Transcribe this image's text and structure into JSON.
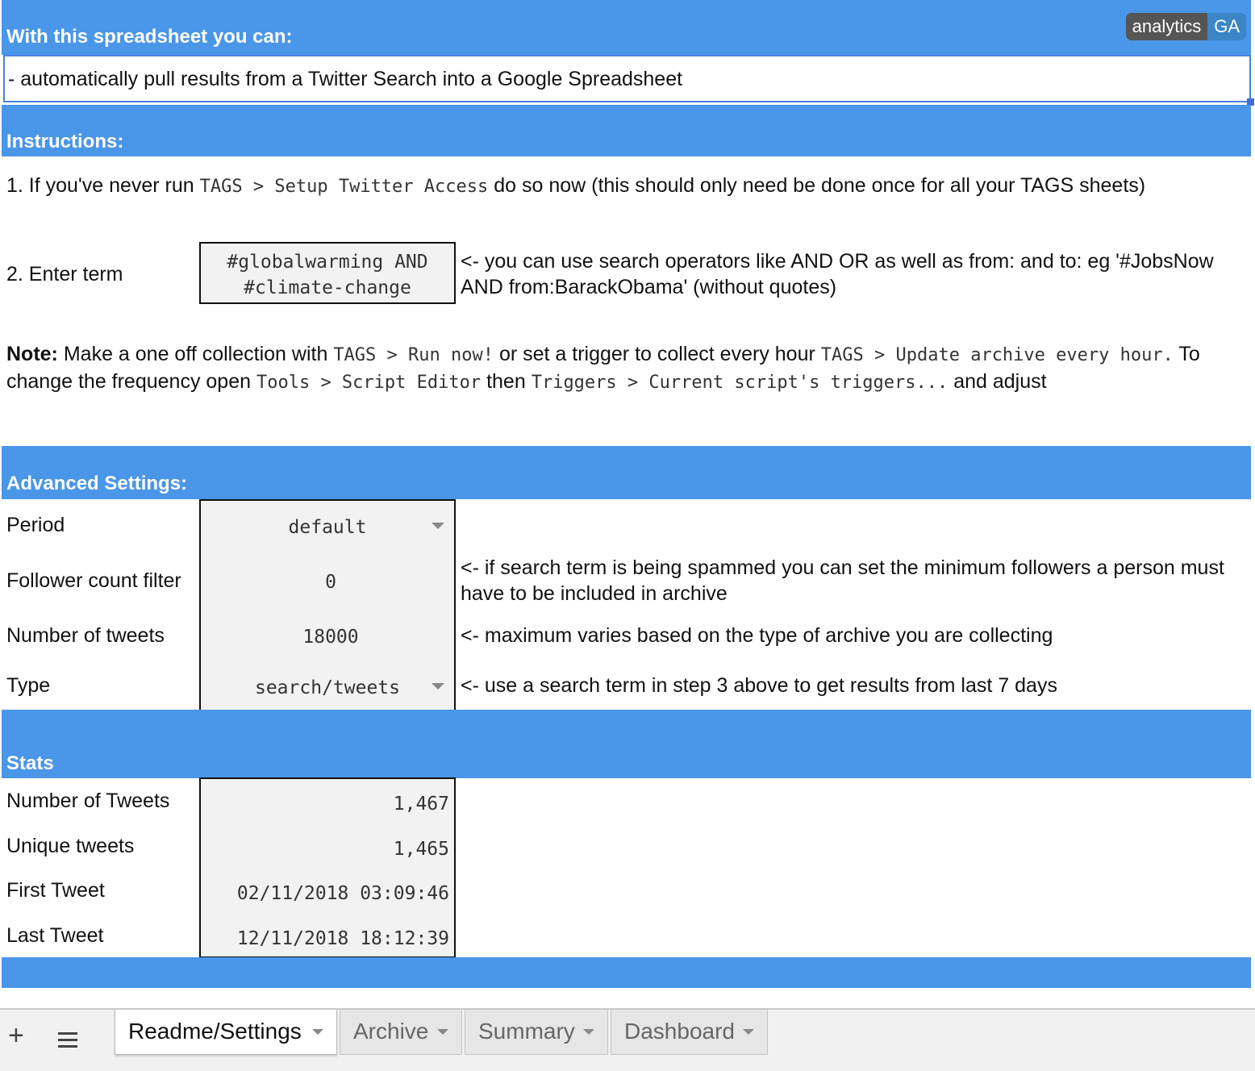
{
  "badge": {
    "left": "analytics",
    "right": "GA"
  },
  "intro": {
    "header": "With this spreadsheet you can:",
    "line": "- automatically pull results from a Twitter Search into a Google Spreadsheet"
  },
  "instructions": {
    "header": "Instructions:",
    "step1": {
      "pre": "1. If you've never run",
      "code": "TAGS > Setup Twitter Access",
      "post": "do so now (this should only need be done once for all your TAGS sheets)"
    },
    "step2": {
      "label": "2. Enter term",
      "term_line1": "#globalwarming AND",
      "term_line2": "#climate-change",
      "hint": "<- you can use search operators like AND OR as well as from: and to: eg '#JobsNow AND from:BarackObama' (without quotes)"
    },
    "note": {
      "label": "Note:",
      "t1": "Make a one off collection with",
      "c1": "TAGS > Run now!",
      "t2": "or set a trigger to collect every hour",
      "c2": "TAGS > Update archive every hour.",
      "t3": "To change the frequency open",
      "c3": "Tools > Script Editor",
      "t4": "then",
      "c4": "Triggers > Current script's triggers...",
      "t5": "and adjust"
    }
  },
  "advanced": {
    "header": "Advanced Settings:",
    "period": {
      "label": "Period",
      "value": "default"
    },
    "follower": {
      "label": "Follower count filter",
      "value": "0",
      "hint": "<- if search term is being spammed you can set the minimum followers a person must have to be included in archive"
    },
    "tweets": {
      "label": "Number of tweets",
      "value": "18000",
      "hint": "<- maximum varies based on the type of archive you are collecting"
    },
    "type": {
      "label": "Type",
      "value": "search/tweets",
      "hint": "<- use a search term in step 3 above to get results from last 7 days"
    }
  },
  "stats": {
    "header": "Stats",
    "rows": [
      {
        "label": "Number of Tweets",
        "value": "1,467"
      },
      {
        "label": "Unique tweets",
        "value": "1,465"
      },
      {
        "label": "First Tweet",
        "value": "02/11/2018 03:09:46"
      },
      {
        "label": "Last Tweet",
        "value": "12/11/2018 18:12:39"
      }
    ]
  },
  "tabs": [
    {
      "label": "Readme/Settings",
      "active": true
    },
    {
      "label": "Archive",
      "active": false
    },
    {
      "label": "Summary",
      "active": false
    },
    {
      "label": "Dashboard",
      "active": false
    }
  ],
  "icons": {
    "add": "plus-icon",
    "list": "menu-icon"
  },
  "colors": {
    "band": "#4a96e8",
    "selection": "#4a7fe0"
  }
}
